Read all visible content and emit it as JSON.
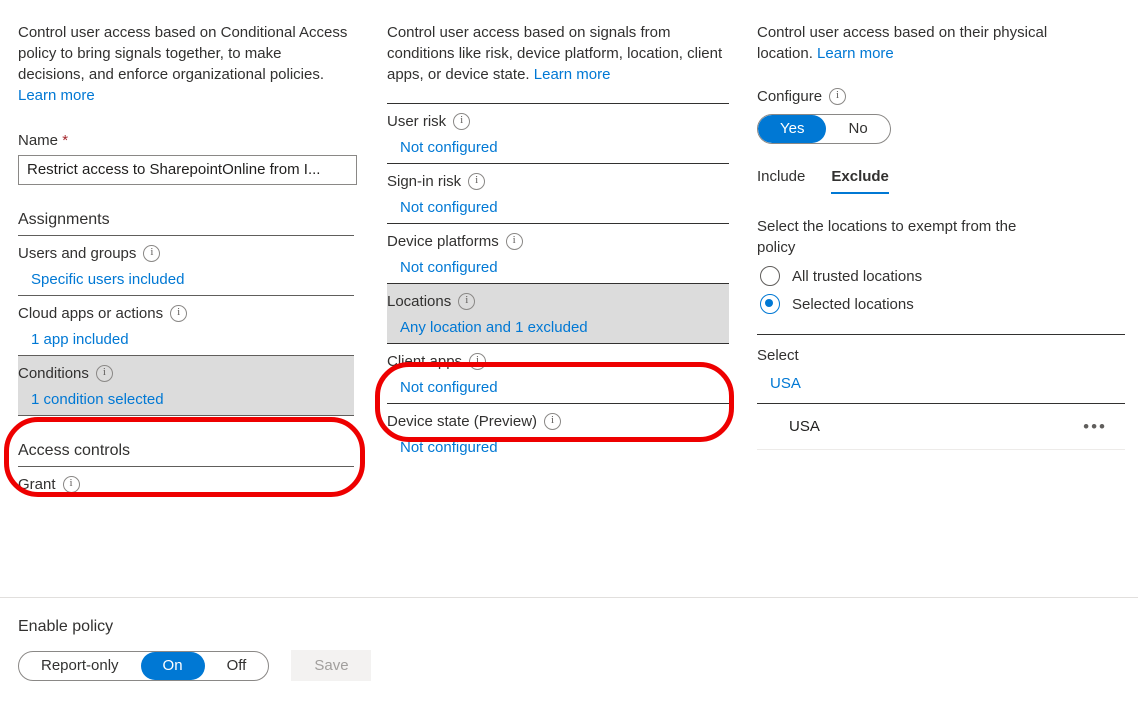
{
  "policy_pane": {
    "intro_text": "Control user access based on Conditional Access policy to bring signals together, to make decisions, and enforce organizational policies.",
    "intro_link": "Learn more",
    "name_label": "Name",
    "name_required_mark": "*",
    "name_value": "Restrict access to SharepointOnline from I...",
    "assignments_header": "Assignments",
    "settings": [
      {
        "label": "Users and groups",
        "value": "Specific users included",
        "icon": "info-icon",
        "highlighted": false
      },
      {
        "label": "Cloud apps or actions",
        "value": "1 app included",
        "icon": "info-icon",
        "highlighted": false
      },
      {
        "label": "Conditions",
        "value": "1 condition selected",
        "icon": "info-icon",
        "highlighted": true
      }
    ],
    "access_controls_header": "Access controls",
    "grant_label": "Grant"
  },
  "conditions_pane": {
    "intro_text": "Control user access based on signals from conditions like risk, device platform, location, client apps, or device state.",
    "intro_link": "Learn more",
    "settings": [
      {
        "label": "User risk",
        "value": "Not configured",
        "icon": "info-icon",
        "highlighted": false
      },
      {
        "label": "Sign-in risk",
        "value": "Not configured",
        "icon": "info-icon",
        "highlighted": false
      },
      {
        "label": "Device platforms",
        "value": "Not configured",
        "icon": "info-icon",
        "highlighted": false
      },
      {
        "label": "Locations",
        "value": "Any location and 1 excluded",
        "icon": "info-icon",
        "highlighted": true
      },
      {
        "label": "Client apps",
        "value": "Not configured",
        "icon": "info-icon",
        "highlighted": false
      },
      {
        "label": "Device state (Preview)",
        "value": "Not configured",
        "icon": "info-icon",
        "highlighted": false
      }
    ]
  },
  "locations_pane": {
    "intro_text": "Control user access based on their physical location.",
    "intro_link": "Learn more",
    "configure_label": "Configure",
    "configure_yes": "Yes",
    "configure_no": "No",
    "configure_selected": "Yes",
    "tabs": [
      {
        "label": "Include",
        "active": false
      },
      {
        "label": "Exclude",
        "active": true
      }
    ],
    "prompt": "Select the locations to exempt from the policy",
    "radios": [
      {
        "label": "All trusted locations",
        "checked": false
      },
      {
        "label": "Selected locations",
        "checked": true
      }
    ],
    "select_label": "Select",
    "select_value": "USA",
    "list_rows": [
      {
        "name": "USA",
        "menu": "•••"
      }
    ]
  },
  "bottom_bar": {
    "enable_label": "Enable policy",
    "enable_options": [
      "Report-only",
      "On",
      "Off"
    ],
    "enable_selected": "On",
    "save_label": "Save"
  },
  "annotations": {
    "color": "#ee0000",
    "boxes": [
      "conditions-row",
      "locations-row"
    ]
  }
}
